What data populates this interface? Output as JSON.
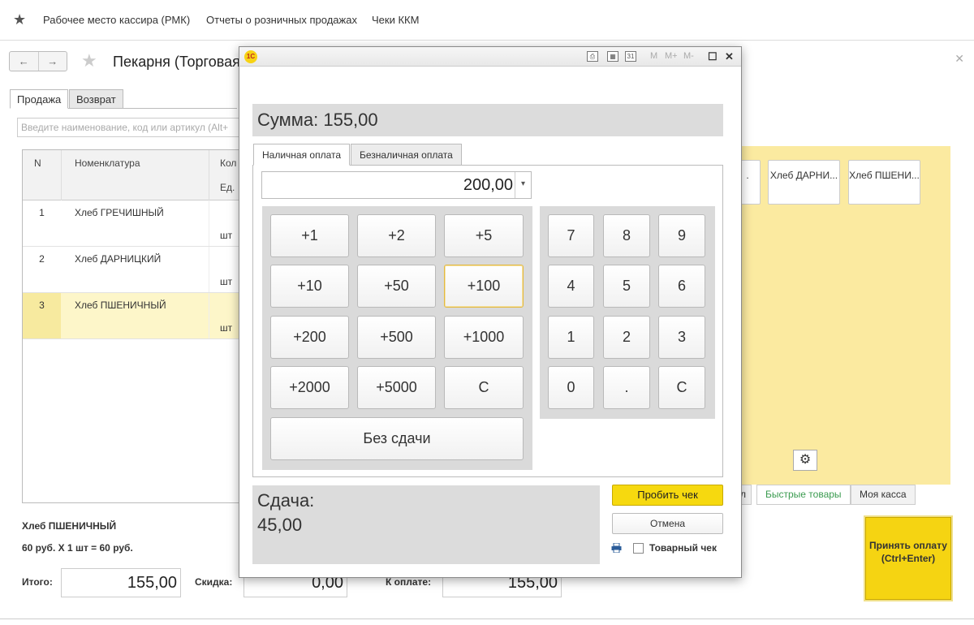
{
  "topnav": {
    "items": [
      "Рабочее место кассира (РМК)",
      "Отчеты о розничных продажах",
      "Чеки ККМ"
    ]
  },
  "form": {
    "title": "Пекарня (Торговая",
    "tabs": [
      "Продажа",
      "Возврат"
    ],
    "search_placeholder": "Введите наименование, код или артикул (Alt+",
    "grid": {
      "headers": {
        "n": "N",
        "name": "Номенклатура",
        "qty": "Кол",
        "unit": "Ед."
      },
      "rows": [
        {
          "n": "1",
          "name": "Хлеб ГРЕЧИШНЫЙ",
          "unit": "шт"
        },
        {
          "n": "2",
          "name": "Хлеб ДАРНИЦКИЙ",
          "unit": "шт"
        },
        {
          "n": "3",
          "name": "Хлеб ПШЕНИЧНЫЙ",
          "unit": "шт"
        }
      ]
    },
    "current_item": "Хлеб ПШЕНИЧНЫЙ",
    "current_calc": "60 руб. X 1 шт = 60 руб.",
    "totals": {
      "total_label": "Итого:",
      "total_value": "155,00",
      "discount_label": "Скидка:",
      "discount_value": "0,00",
      "due_label": "К оплате:",
      "due_value": "155,00"
    }
  },
  "quick": {
    "buttons": [
      ".",
      "Хлеб ДАРНИ...",
      "Хлеб ПШЕНИ..."
    ],
    "tabs": [
      "л",
      "Быстрые товары",
      "Моя касса"
    ],
    "accept": "Принять оплату (Ctrl+Enter)"
  },
  "modal": {
    "logo": "1С",
    "toolbar_m": [
      "M",
      "M+",
      "M-"
    ],
    "sum": "Сумма: 155,00",
    "tabs": [
      "Наличная оплата",
      "Безналичная оплата"
    ],
    "amount": "200,00",
    "quick_keys": [
      "+1",
      "+2",
      "+5",
      "+10",
      "+50",
      "+100",
      "+200",
      "+500",
      "+1000",
      "+2000",
      "+5000",
      "C"
    ],
    "no_change": "Без сдачи",
    "numpad": [
      "7",
      "8",
      "9",
      "4",
      "5",
      "6",
      "1",
      "2",
      "3",
      "0",
      ".",
      "C"
    ],
    "change_label": "Сдача:",
    "change_value": "45,00",
    "print_button": "Пробить чек",
    "cancel_button": "Отмена",
    "receipt_label": "Товарный чек"
  },
  "colors": {
    "accent_yellow": "#f6d90f",
    "panel_yellow": "#fbeaa0",
    "tab_green": "#3a9b4f"
  }
}
